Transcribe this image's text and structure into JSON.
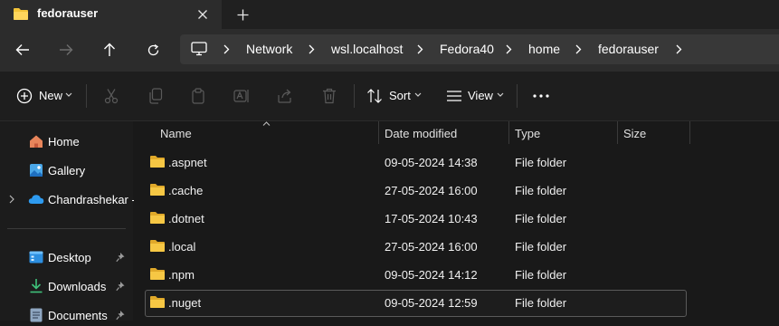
{
  "window": {
    "tab_title": "fedorauser"
  },
  "address": {
    "crumbs": [
      "Network",
      "wsl.localhost",
      "Fedora40",
      "home",
      "fedorauser"
    ]
  },
  "toolbar": {
    "new_label": "New",
    "sort_label": "Sort",
    "view_label": "View"
  },
  "sidebar": {
    "items": [
      {
        "label": "Home",
        "icon": "home-icon"
      },
      {
        "label": "Gallery",
        "icon": "gallery-icon"
      },
      {
        "label": "Chandrashekar -",
        "icon": "onedrive-cloud-icon"
      },
      {
        "label": "Desktop",
        "icon": "desktop-icon",
        "pinned": true
      },
      {
        "label": "Downloads",
        "icon": "download-icon",
        "pinned": true
      },
      {
        "label": "Documents",
        "icon": "documents-icon",
        "pinned": true
      }
    ]
  },
  "columns": {
    "name": "Name",
    "date": "Date modified",
    "type": "Type",
    "size": "Size"
  },
  "files": [
    {
      "name": ".aspnet",
      "date": "09-05-2024 14:38",
      "type": "File folder",
      "size": ""
    },
    {
      "name": ".cache",
      "date": "27-05-2024 16:00",
      "type": "File folder",
      "size": ""
    },
    {
      "name": ".dotnet",
      "date": "17-05-2024 10:43",
      "type": "File folder",
      "size": ""
    },
    {
      "name": ".local",
      "date": "27-05-2024 16:00",
      "type": "File folder",
      "size": ""
    },
    {
      "name": ".npm",
      "date": "09-05-2024 14:12",
      "type": "File folder",
      "size": ""
    },
    {
      "name": ".nuget",
      "date": "09-05-2024 12:59",
      "type": "File folder",
      "size": ""
    }
  ],
  "colors": {
    "folder": "#f3c338",
    "accent": "#4cc2ff"
  }
}
